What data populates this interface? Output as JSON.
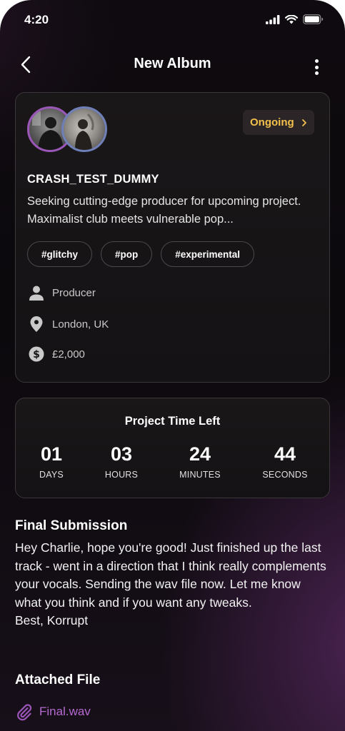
{
  "status_bar": {
    "time": "4:20",
    "icons": [
      "signal-icon",
      "wifi-icon",
      "battery-icon"
    ]
  },
  "header": {
    "title": "New Album",
    "back_icon": "chevron-left-icon",
    "menu_icon": "more-vertical-icon"
  },
  "project": {
    "status": "Ongoing",
    "username": "CRASH_TEST_DUMMY",
    "description": "Seeking cutting-edge producer for upcoming project. Maximalist club meets vulnerable pop...",
    "tags": [
      "#glitchy",
      "#pop",
      "#experimental"
    ],
    "role": "Producer",
    "location": "London, UK",
    "budget": "£2,000"
  },
  "timer": {
    "title": "Project Time Left",
    "units": [
      {
        "value": "01",
        "label": "DAYS"
      },
      {
        "value": "03",
        "label": "HOURS"
      },
      {
        "value": "24",
        "label": "MINUTES"
      },
      {
        "value": "44",
        "label": "SECONDS"
      }
    ]
  },
  "submission": {
    "title": "Final Submission",
    "message": "Hey Charlie, hope you're good! Just finished up the last track - went in a direction that I think really complements your vocals. Sending the wav file now. Let me know what you think and if you want any tweaks.\nBest, Korrupt"
  },
  "attachment": {
    "title": "Attached File",
    "filename": "Final.wav"
  },
  "colors": {
    "accent_gold": "#f3c04a",
    "accent_purple": "#b46ad0",
    "background": "#0e0a0f"
  }
}
